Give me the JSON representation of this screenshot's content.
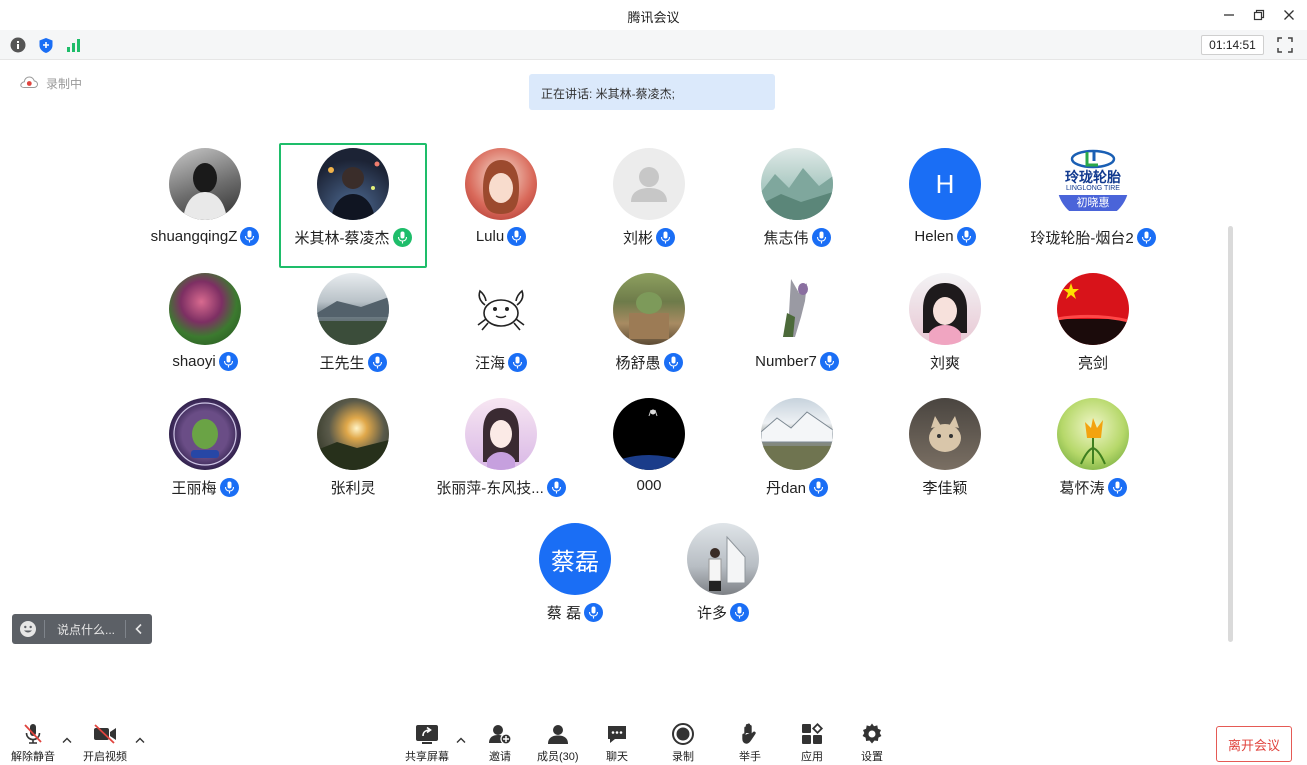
{
  "window": {
    "title": "腾讯会议"
  },
  "toolstrip": {
    "timer": "01:14:51"
  },
  "recording": {
    "label": "录制中"
  },
  "speaking": {
    "label": "正在讲话: 米其林-蔡凌杰;"
  },
  "participants": [
    {
      "name": "shuangqingZ",
      "mic": "blue"
    },
    {
      "name": "米其林-蔡凌杰",
      "mic": "green"
    },
    {
      "name": "Lulu",
      "mic": "blue"
    },
    {
      "name": "刘彬",
      "mic": "blue"
    },
    {
      "name": "焦志伟",
      "mic": "blue"
    },
    {
      "name": "Helen",
      "mic": "blue",
      "initial": "H"
    },
    {
      "name": "玲珑轮胎-烟台2",
      "mic": "blue",
      "logo_text": "玲珑轮胎",
      "logo_sub": "LINGLONG TIRE",
      "logo_tag": "初晓惠"
    },
    {
      "name": "shaoyi",
      "mic": "blue"
    },
    {
      "name": "王先生",
      "mic": "blue"
    },
    {
      "name": "汪海",
      "mic": "blue"
    },
    {
      "name": "杨舒愚",
      "mic": "blue"
    },
    {
      "name": "Number7",
      "mic": "blue"
    },
    {
      "name": "刘爽",
      "mic": "none"
    },
    {
      "name": "亮剑",
      "mic": "none"
    },
    {
      "name": "王丽梅",
      "mic": "blue"
    },
    {
      "name": "张利灵",
      "mic": "none"
    },
    {
      "name": "张丽萍-东风技...",
      "mic": "blue"
    },
    {
      "name": "000",
      "mic": "none"
    },
    {
      "name": "丹dan",
      "mic": "blue"
    },
    {
      "name": "李佳颖",
      "mic": "none"
    },
    {
      "name": "葛怀涛",
      "mic": "blue"
    },
    {
      "name": "蔡 磊",
      "mic": "blue",
      "initial": "蔡磊"
    },
    {
      "name": "许多",
      "mic": "blue"
    }
  ],
  "chat": {
    "placeholder": "说点什么..."
  },
  "bottom": {
    "unmute": "解除静音",
    "start_video": "开启视频",
    "share": "共享屏幕",
    "invite": "邀请",
    "members": "成员(30)",
    "chat": "聊天",
    "record": "录制",
    "raise_hand": "举手",
    "apps": "应用",
    "settings": "设置",
    "leave": "离开会议"
  },
  "colors": {
    "accent": "#1a6ef5",
    "speaking": "#1ebd6a",
    "leave": "#e0443e"
  }
}
